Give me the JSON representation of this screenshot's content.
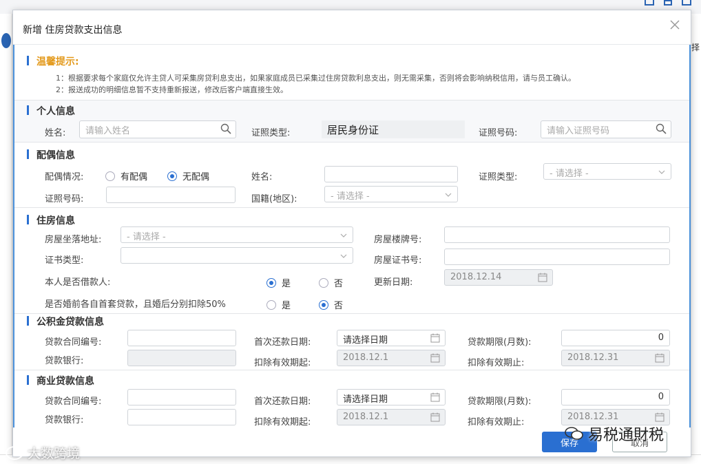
{
  "dialog": {
    "title": "新增 住房贷款支出信息"
  },
  "tips": {
    "title": "温馨提示:",
    "line1": "1：根据要求每个家庭仅允许主贷人可采集房贷利息支出，如果家庭成员已采集过住房贷款利息支出，则无需采集，否则将会影响纳税信用，请与员工确认。",
    "line2": "2：报送成功的明细信息暂不支持重新报送，修改后客户端直接生效。"
  },
  "personal": {
    "title": "个人信息",
    "name_label": "姓名:",
    "name_placeholder": "请输入姓名",
    "id_type_label": "证照类型:",
    "id_type_value": "居民身份证",
    "id_no_label": "证照号码:",
    "id_no_placeholder": "请输入证照号码"
  },
  "spouse": {
    "title": "配偶信息",
    "status_label": "配偶情况:",
    "has_spouse": "有配偶",
    "no_spouse": "无配偶",
    "name_label": "姓名:",
    "id_type_label": "证照类型:",
    "id_type_placeholder": "- 请选择 -",
    "id_no_label": "证照号码:",
    "nationality_label": "国籍(地区):",
    "nationality_placeholder": "- 请选择 -"
  },
  "housing": {
    "title": "住房信息",
    "address_label": "房屋坐落地址:",
    "address_placeholder": "- 请选择 -",
    "house_no_label": "房屋楼牌号:",
    "cert_type_label": "证书类型:",
    "cert_no_label": "房屋证书号:",
    "is_borrower_label": "本人是否借款人:",
    "yes": "是",
    "no": "否",
    "update_date_label": "更新日期:",
    "update_date_value": "2018.12.14",
    "premarital_label": "是否婚前各自首套贷款，且婚后分别扣除50%"
  },
  "provident": {
    "title": "公积金贷款信息",
    "contract_label": "贷款合同编号:",
    "first_repay_label": "首次还款日期:",
    "first_repay_placeholder": "请选择日期",
    "term_label": "贷款期限(月数):",
    "term_value": "0",
    "bank_label": "贷款银行:",
    "deduct_start_label": "扣除有效期起:",
    "deduct_start_value": "2018.12.1",
    "deduct_end_label": "扣除有效期止:",
    "deduct_end_value": "2018.12.31"
  },
  "commercial": {
    "title": "商业贷款信息",
    "contract_label": "贷款合同编号:",
    "first_repay_label": "首次还款日期:",
    "first_repay_placeholder": "请选择日期",
    "term_label": "贷款期限(月数):",
    "term_value": "0",
    "bank_label": "贷款银行:",
    "deduct_start_label": "扣除有效期起:",
    "deduct_start_value": "2018.12.1",
    "deduct_end_label": "扣除有效期止:",
    "deduct_end_value": "2018.12.31"
  },
  "footer": {
    "save": "保存",
    "cancel": "取消"
  },
  "watermarks": {
    "left": "大数跨境",
    "right": "易税通財税"
  },
  "background": {
    "right_char": "择"
  },
  "colors": {
    "accent": "#2a6fd1",
    "tips": "#e39a1d"
  }
}
